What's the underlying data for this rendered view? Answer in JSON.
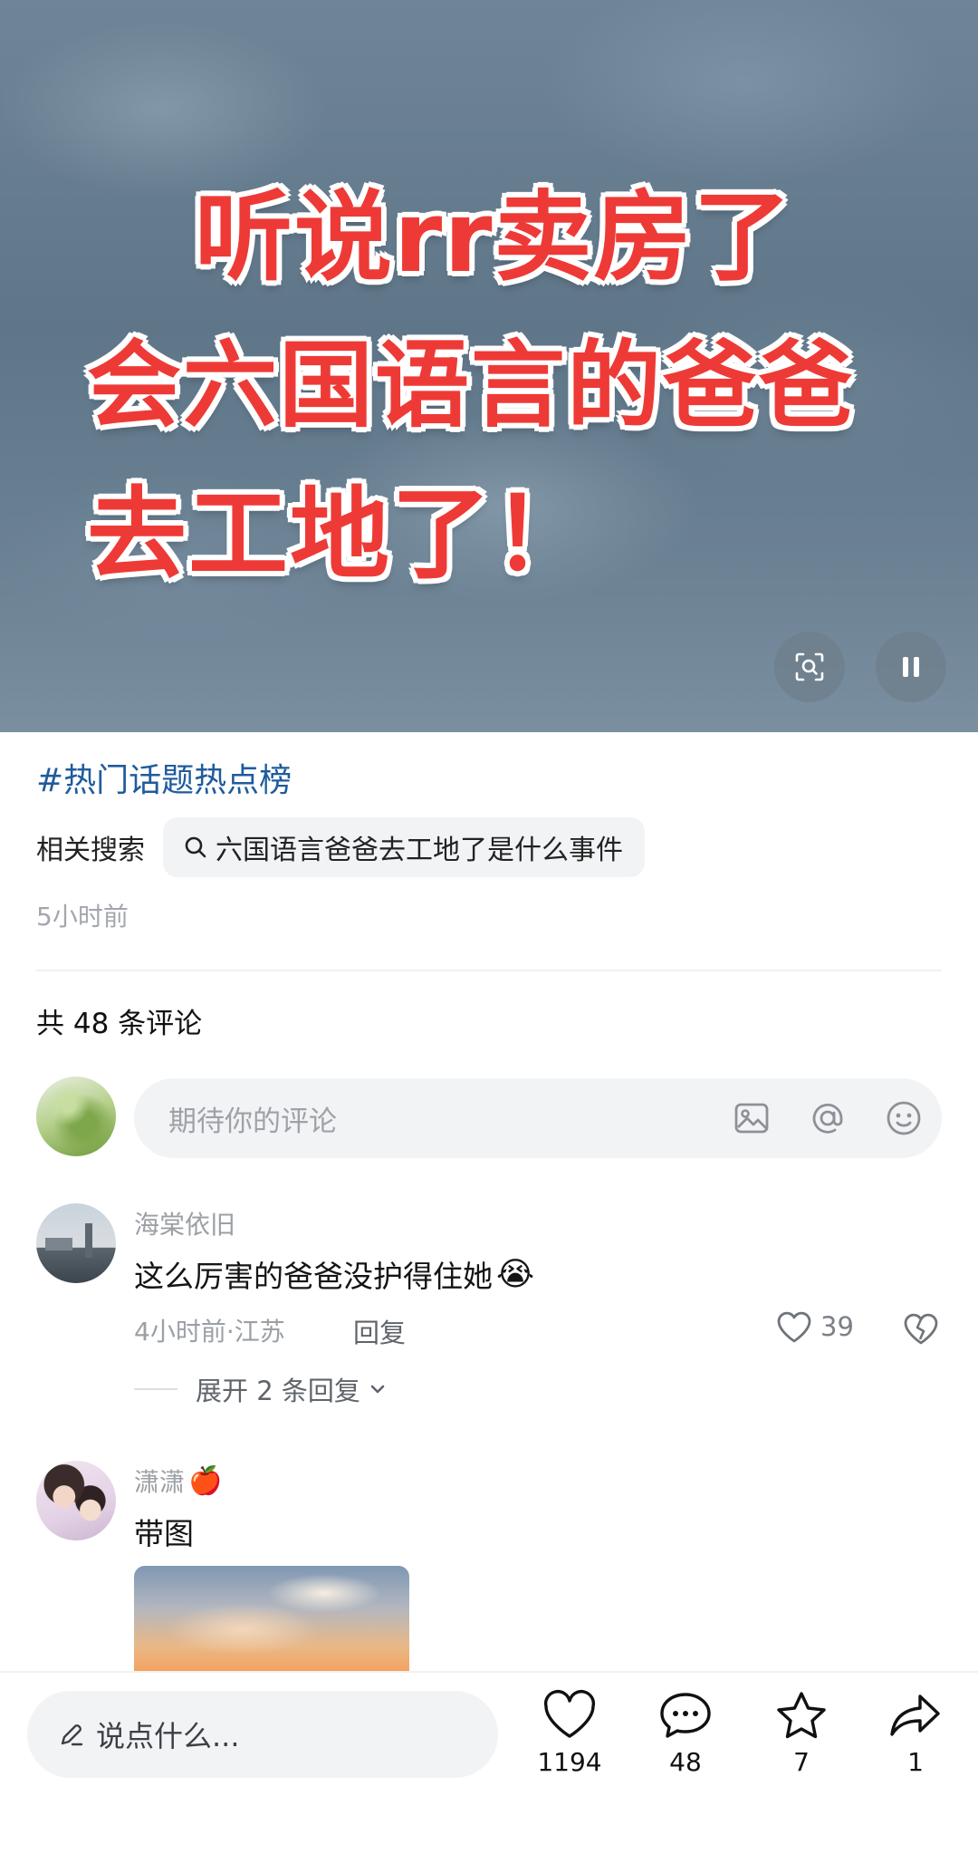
{
  "hero": {
    "line1": "听说rr卖房了",
    "line2": "会六国语言的爸爸",
    "line3": "去工地了！",
    "icons": [
      "screen-search-icon",
      "pause-icon"
    ]
  },
  "post": {
    "topic": "#热门话题热点榜",
    "related_label": "相关搜索",
    "related_query": "六国语言爸爸去工地了是什么事件",
    "posted_time": "5小时前"
  },
  "comments_header": {
    "count_text": "共 48 条评论"
  },
  "composer": {
    "placeholder": "期待你的评论",
    "icons": [
      "image-icon",
      "at-icon",
      "emoji-icon"
    ]
  },
  "comments": [
    {
      "user": "海棠依旧",
      "text": "这么厉害的爸爸没护得住她",
      "emoji": "😭",
      "meta": "4小时前·江苏",
      "reply_label": "回复",
      "likes": "39",
      "expand_text": "展开 2 条回复"
    },
    {
      "user": "潇潇",
      "user_emoji": "🍎",
      "text": "带图"
    }
  ],
  "bottom_bar": {
    "say_placeholder": "说点什么...",
    "likes": "1194",
    "comments": "48",
    "favorites": "7",
    "shares": "1"
  },
  "colors": {
    "topic_link": "#1f5b9c",
    "hero_text": "#ee3a36",
    "muted": "#9ba0a6"
  }
}
